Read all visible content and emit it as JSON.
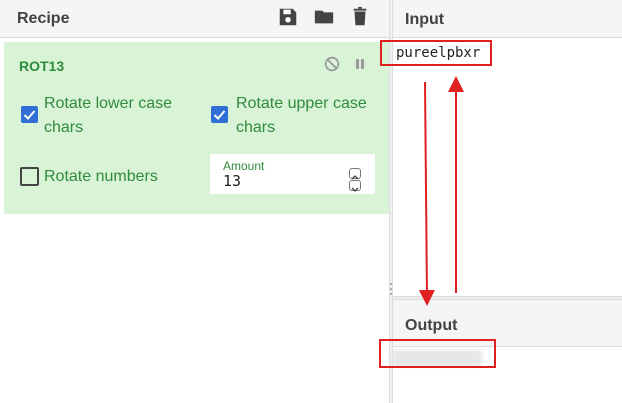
{
  "recipe": {
    "title": "Recipe",
    "toolbar_icons": [
      "save-icon",
      "folder-icon",
      "trash-icon"
    ],
    "operation": {
      "name": "ROT13",
      "options": [
        {
          "label_line1": "Rotate lower case",
          "label_line2": "chars",
          "checked": true
        },
        {
          "label_line1": "Rotate upper case",
          "label_line2": "chars",
          "checked": true
        },
        {
          "label_line1": "Rotate numbers",
          "label_line2": "",
          "checked": false
        }
      ],
      "amount": {
        "label": "Amount",
        "value": "13"
      }
    }
  },
  "input": {
    "title": "Input",
    "text": "pureelpbxr"
  },
  "output": {
    "title": "Output",
    "text": ""
  },
  "colors": {
    "card_bg": "#d9f3d6",
    "accent_green": "#2e8b3b",
    "checkbox_blue": "#2f6fd6",
    "annotation_red": "#e02020"
  }
}
